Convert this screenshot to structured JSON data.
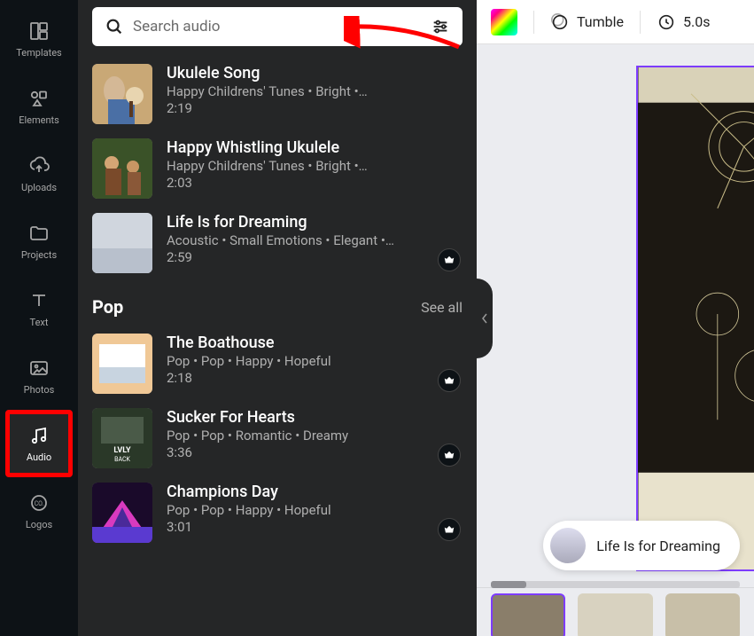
{
  "sidebar": {
    "items": [
      {
        "label": "Templates",
        "icon": "templates"
      },
      {
        "label": "Elements",
        "icon": "elements"
      },
      {
        "label": "Uploads",
        "icon": "uploads"
      },
      {
        "label": "Projects",
        "icon": "projects"
      },
      {
        "label": "Text",
        "icon": "text"
      },
      {
        "label": "Photos",
        "icon": "photos"
      },
      {
        "label": "Audio",
        "icon": "audio"
      },
      {
        "label": "Logos",
        "icon": "logos"
      }
    ],
    "active": "Audio"
  },
  "search": {
    "placeholder": "Search audio"
  },
  "tracks": [
    {
      "title": "Ukulele Song",
      "meta": "Happy Childrens' Tunes • Bright •…",
      "duration": "2:19",
      "thumb": "ukulele",
      "badge": false
    },
    {
      "title": "Happy Whistling Ukulele",
      "meta": "Happy Childrens' Tunes • Bright •…",
      "duration": "2:03",
      "thumb": "whistle",
      "badge": false
    },
    {
      "title": "Life Is for Dreaming",
      "meta": "Acoustic • Small Emotions • Elegant •…",
      "duration": "2:59",
      "thumb": "dreaming",
      "badge": true
    }
  ],
  "pop": {
    "title": "Pop",
    "see_all": "See all",
    "tracks": [
      {
        "title": "The Boathouse",
        "meta": "Pop • Pop • Happy • Hopeful",
        "duration": "2:18",
        "thumb": "boathouse",
        "badge": true
      },
      {
        "title": "Sucker For Hearts",
        "meta": "Pop • Pop • Romantic • Dreamy",
        "duration": "3:36",
        "thumb": "sucker",
        "badge": true
      },
      {
        "title": "Champions Day",
        "meta": "Pop • Pop • Happy • Hopeful",
        "duration": "3:01",
        "thumb": "champions",
        "badge": true
      }
    ]
  },
  "toolbar": {
    "animation": "Tumble",
    "timing_label": "5.0s"
  },
  "now_playing": {
    "title": "Life Is for Dreaming"
  }
}
